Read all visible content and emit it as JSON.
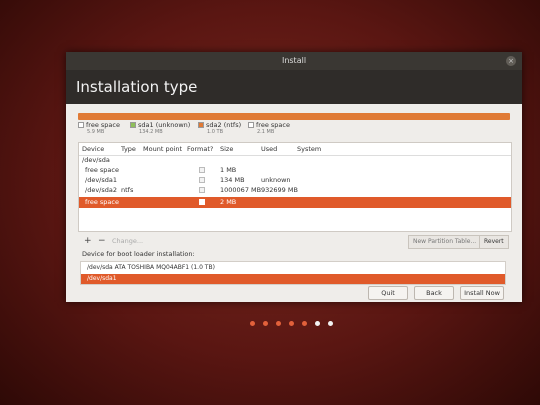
{
  "window": {
    "title": "Install",
    "close_glyph": "×"
  },
  "header": {
    "title": "Installation type"
  },
  "partition_bar": {
    "accent": "#e07a35"
  },
  "legend": [
    {
      "name": "free space",
      "size": "5.9 MB",
      "color": "#ffffff"
    },
    {
      "name": "sda1 (unknown)",
      "size": "134.2 MB",
      "color": "#8fbf5a"
    },
    {
      "name": "sda2 (ntfs)",
      "size": "1.0 TB",
      "color": "#e07a35"
    },
    {
      "name": "free space",
      "size": "2.1 MB",
      "color": "#ffffff"
    }
  ],
  "table": {
    "headers": [
      "Device",
      "Type",
      "Mount point",
      "Format?",
      "Size",
      "Used",
      "System"
    ],
    "rows": [
      {
        "device": "/dev/sda",
        "type": "",
        "mount": "",
        "size": "",
        "used": "",
        "system": "",
        "checkbox": false,
        "selected": false
      },
      {
        "device": "free space",
        "type": "",
        "mount": "",
        "size": "1 MB",
        "used": "",
        "system": "",
        "checkbox": true,
        "selected": false
      },
      {
        "device": "/dev/sda1",
        "type": "",
        "mount": "",
        "size": "134 MB",
        "used": "unknown",
        "system": "",
        "checkbox": true,
        "selected": false
      },
      {
        "device": "/dev/sda2",
        "type": "ntfs",
        "mount": "",
        "size": "1000067 MB",
        "used": "932699 MB",
        "system": "",
        "checkbox": true,
        "selected": false
      },
      {
        "device": "free space",
        "type": "",
        "mount": "",
        "size": "2 MB",
        "used": "",
        "system": "",
        "checkbox": true,
        "selected": true
      }
    ]
  },
  "toolbar": {
    "add": "+",
    "remove": "−",
    "change": "Change...",
    "new_table": "New Partition Table...",
    "revert": "Revert"
  },
  "bootloader": {
    "label": "Device for boot loader installation:",
    "items": [
      "/dev/sda   ATA TOSHIBA MQ04ABF1 (1.0 TB)",
      "/dev/sda1"
    ],
    "selected_index": 1
  },
  "buttons": {
    "quit": "Quit",
    "back": "Back",
    "install": "Install Now"
  },
  "progress_dots": {
    "colors": [
      "#e2613b",
      "#e2613b",
      "#e2613b",
      "#e2613b",
      "#e2613b",
      "#f2f2f2",
      "#f2f2f2"
    ]
  }
}
